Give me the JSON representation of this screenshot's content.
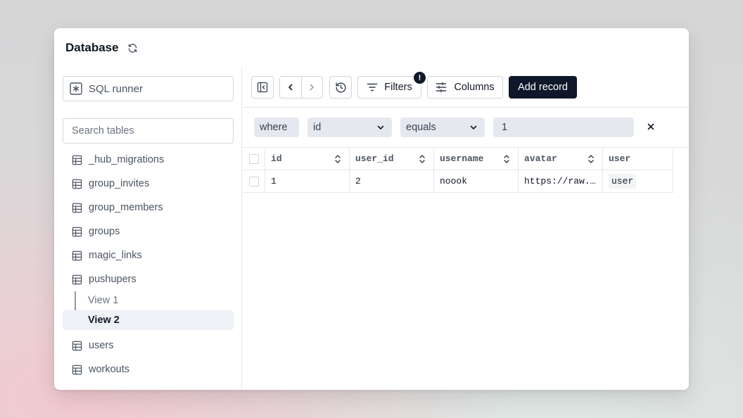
{
  "window": {
    "title": "Database"
  },
  "sidebar": {
    "sql_runner_label": "SQL runner",
    "search_placeholder": "Search tables",
    "tables": [
      {
        "label": "_hub_migrations"
      },
      {
        "label": "group_invites"
      },
      {
        "label": "group_members"
      },
      {
        "label": "groups"
      },
      {
        "label": "magic_links"
      },
      {
        "label": "pushupers"
      },
      {
        "label": "users"
      },
      {
        "label": "workouts"
      }
    ],
    "views": [
      {
        "label": "View 1",
        "active": false
      },
      {
        "label": "View 2",
        "active": true
      }
    ]
  },
  "toolbar": {
    "filters_label": "Filters",
    "filters_badge": "!",
    "columns_label": "Columns",
    "add_record_label": "Add record"
  },
  "filter": {
    "where_label": "where",
    "field": "id",
    "operator": "equals",
    "value": "1"
  },
  "grid": {
    "columns": [
      "id",
      "user_id",
      "username",
      "avatar",
      "user"
    ],
    "rows": [
      {
        "id": "1",
        "user_id": "2",
        "username": "noook",
        "avatar": "https://raw.githubusercontent.com/",
        "user": "user"
      }
    ]
  },
  "colors": {
    "primary": "#0f172a",
    "active_item_bg": "#eef2f7",
    "chip_bg": "#e5e9ef",
    "border": "#e5e7eb"
  }
}
